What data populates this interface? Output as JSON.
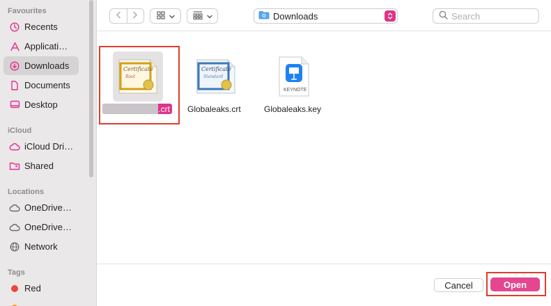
{
  "sidebar": {
    "sections": [
      {
        "title": "Favourites",
        "items": [
          {
            "label": "Recents",
            "icon": "clock-icon"
          },
          {
            "label": "Applicati…",
            "icon": "applications-icon"
          },
          {
            "label": "Downloads",
            "icon": "downloads-icon",
            "selected": true
          },
          {
            "label": "Documents",
            "icon": "document-icon"
          },
          {
            "label": "Desktop",
            "icon": "desktop-icon"
          }
        ]
      },
      {
        "title": "iCloud",
        "items": [
          {
            "label": "iCloud Dri…",
            "icon": "cloud-icon"
          },
          {
            "label": "Shared",
            "icon": "shared-folder-icon"
          }
        ]
      },
      {
        "title": "Locations",
        "items": [
          {
            "label": "OneDrive…",
            "icon": "cloud-icon"
          },
          {
            "label": "OneDrive…",
            "icon": "cloud-icon"
          },
          {
            "label": "Network",
            "icon": "globe-icon"
          }
        ]
      },
      {
        "title": "Tags",
        "items": [
          {
            "label": "Red",
            "icon": "tag-dot-icon",
            "color": "#f0453a"
          }
        ]
      }
    ]
  },
  "toolbar": {
    "back_icon": "chevron-left-icon",
    "forward_icon": "chevron-right-icon",
    "location": "Downloads",
    "search_placeholder": "Search"
  },
  "files": [
    {
      "name": ".crt",
      "kind": "certificate",
      "selected": true
    },
    {
      "name": "Globaleaks.crt",
      "kind": "certificate"
    },
    {
      "name": "Globaleaks.key",
      "kind": "keynote",
      "badge": "KEYNOTE"
    }
  ],
  "buttons": {
    "cancel": "Cancel",
    "open": "Open"
  },
  "colors": {
    "accent": "#e0338a",
    "annotation": "#e23b2e"
  }
}
